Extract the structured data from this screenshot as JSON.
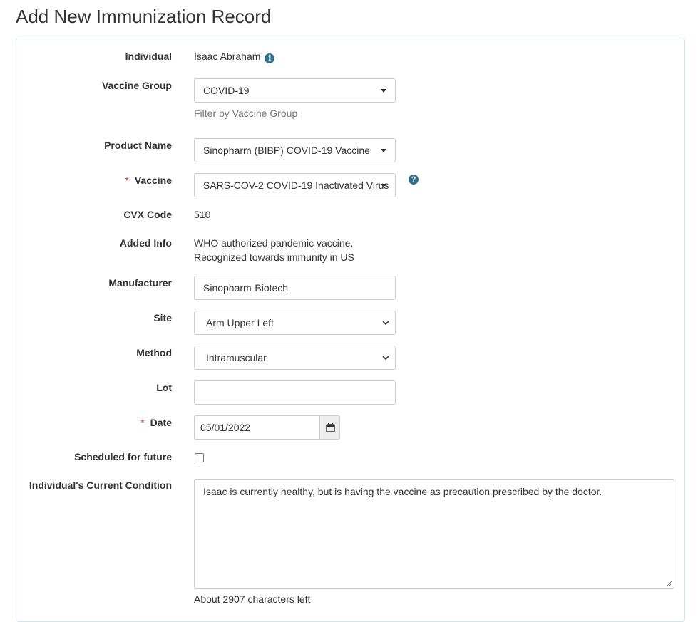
{
  "page_title": "Add New Immunization Record",
  "individual": {
    "label": "Individual",
    "value": "Isaac Abraham",
    "icon": "info-circle-icon"
  },
  "vaccine_group": {
    "label": "Vaccine Group",
    "value": "COVID-19",
    "help": "Filter by Vaccine Group"
  },
  "product_name": {
    "label": "Product Name",
    "value": "Sinopharm (BIBP) COVID-19 Vaccine"
  },
  "vaccine": {
    "label": "Vaccine",
    "required_mark": "*",
    "value": "SARS-COV-2 COVID-19 Inactivated Virus",
    "icon": "question-circle-icon"
  },
  "cvx_code": {
    "label": "CVX Code",
    "value": "510"
  },
  "added_info": {
    "label": "Added Info",
    "line1": "WHO authorized pandemic vaccine.",
    "line2": "Recognized towards immunity in US"
  },
  "manufacturer": {
    "label": "Manufacturer",
    "value": "Sinopharm-Biotech"
  },
  "site": {
    "label": "Site",
    "value": "Arm Upper Left"
  },
  "method": {
    "label": "Method",
    "value": "Intramuscular"
  },
  "lot": {
    "label": "Lot",
    "value": ""
  },
  "date": {
    "label": "Date",
    "required_mark": "*",
    "value": "05/01/2022",
    "icon": "calendar-icon"
  },
  "scheduled": {
    "label": "Scheduled for future",
    "checked": false
  },
  "condition": {
    "label": "Individual's Current Condition",
    "value": "Isaac is currently healthy, but is having the vaccine as precaution prescribed by the doctor.",
    "chars_left": "About 2907 characters left"
  },
  "colors": {
    "panel_border": "#d0e6ef",
    "info_icon": "#31708f",
    "required": "#a94442",
    "help_text": "#777777"
  }
}
